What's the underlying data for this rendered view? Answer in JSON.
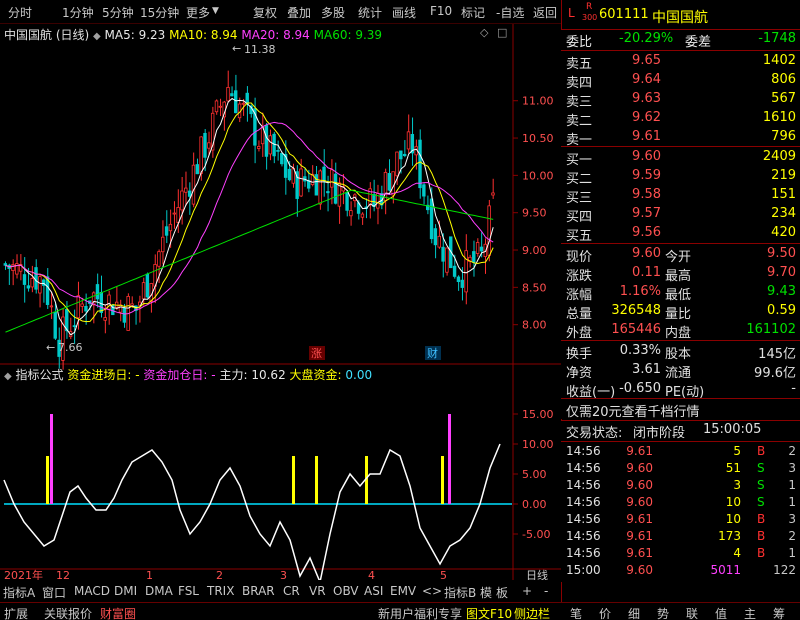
{
  "toolbar": {
    "left": [
      "分时",
      "1分钟",
      "5分钟",
      "15分钟",
      "更多"
    ],
    "right": [
      "复权",
      "叠加",
      "多股",
      "统计",
      "画线",
      "F10",
      "标记",
      "-自选",
      "返回"
    ]
  },
  "chart": {
    "title": "中国国航 (日线)",
    "ma5": "MA5: 9.23",
    "ma10": "MA10: 8.94",
    "ma20": "MA20: 8.94",
    "ma60": "MA60: 9.39",
    "high_label": "11.38",
    "low_label": "7.66",
    "price_ticks": [
      "11.00",
      "10.50",
      "10.00",
      "9.50",
      "9.00",
      "8.50",
      "8.00"
    ],
    "marker_zhang": "涨",
    "marker_cai": "财",
    "colors": {
      "up": "#ff3030",
      "down": "#00c8c8",
      "ma5": "#ffffff",
      "ma10": "#ffff00",
      "ma20": "#ff40ff",
      "ma60": "#00e000"
    }
  },
  "indicator": {
    "name": "指标公式",
    "jczc": "资金进场日:",
    "jczc_v": "-",
    "jjjc": "资金加仓日:",
    "jjjc_v": "-",
    "zl": "主力:",
    "zl_v": "10.62",
    "dp": "大盘资金:",
    "dp_v": "0.00",
    "ticks": [
      "15.00",
      "10.00",
      "5.00",
      "0.00",
      "-5.00"
    ]
  },
  "xaxis": {
    "labels": [
      "2021年",
      "12",
      "1",
      "2",
      "3",
      "4",
      "5"
    ],
    "right": "日线"
  },
  "tabs": [
    "指标A",
    "窗口",
    "MACD",
    "DMI",
    "DMA",
    "FSL",
    "TRIX",
    "BRAR",
    "CR",
    "VR",
    "OBV",
    "ASI",
    "EMV",
    "<",
    ">",
    "指标B",
    "模",
    "板",
    "+",
    "-"
  ],
  "status": {
    "left": [
      "扩展",
      "关联报价",
      "财富圈"
    ],
    "promo": "新用户福利专享",
    "mid": [
      "图文F10",
      "侧边栏"
    ],
    "right": [
      "笔",
      "价",
      "细",
      "势",
      "联",
      "值",
      "主",
      "筹"
    ]
  },
  "quote": {
    "badge_top": "L",
    "badge_r": "R",
    "badge_num": "300",
    "code": "601111",
    "name": "中国国航",
    "weibi_label": "委比",
    "weibi": "-20.29%",
    "weicha_label": "委差",
    "weicha": "-1748",
    "asks": [
      {
        "label": "卖五",
        "price": "9.65",
        "vol": "1402"
      },
      {
        "label": "卖四",
        "price": "9.64",
        "vol": "806"
      },
      {
        "label": "卖三",
        "price": "9.63",
        "vol": "567"
      },
      {
        "label": "卖二",
        "price": "9.62",
        "vol": "1610"
      },
      {
        "label": "卖一",
        "price": "9.61",
        "vol": "796"
      }
    ],
    "bids": [
      {
        "label": "买一",
        "price": "9.60",
        "vol": "2409"
      },
      {
        "label": "买二",
        "price": "9.59",
        "vol": "219"
      },
      {
        "label": "买三",
        "price": "9.58",
        "vol": "151"
      },
      {
        "label": "买四",
        "price": "9.57",
        "vol": "234"
      },
      {
        "label": "买五",
        "price": "9.56",
        "vol": "420"
      }
    ],
    "stats": [
      {
        "l1": "现价",
        "v1": "9.60",
        "l2": "今开",
        "v2": "9.50"
      },
      {
        "l1": "涨跌",
        "v1": "0.11",
        "l2": "最高",
        "v2": "9.70"
      },
      {
        "l1": "涨幅",
        "v1": "1.16%",
        "l2": "最低",
        "v2": "9.43"
      },
      {
        "l1": "总量",
        "v1": "326548",
        "l2": "量比",
        "v2": "0.59"
      },
      {
        "l1": "外盘",
        "v1": "165446",
        "l2": "内盘",
        "v2": "161102"
      }
    ],
    "stats2": [
      {
        "l1": "换手",
        "v1": "0.33%",
        "l2": "股本",
        "v2": "145亿"
      },
      {
        "l1": "净资",
        "v1": "3.61",
        "l2": "流通",
        "v2": "99.6亿"
      },
      {
        "l1": "收益(一)",
        "v1": "-0.650",
        "l2": "PE(动)",
        "v2": "-"
      }
    ],
    "promo": "仅需20元查看千档行情",
    "trade_status_label": "交易状态:",
    "trade_status": "闭市阶段",
    "trade_time": "15:00:05",
    "ticks": [
      {
        "t": "14:56",
        "p": "9.61",
        "v": "5",
        "d": "B",
        "n": "2"
      },
      {
        "t": "14:56",
        "p": "9.60",
        "v": "51",
        "d": "S",
        "n": "3"
      },
      {
        "t": "14:56",
        "p": "9.60",
        "v": "3",
        "d": "S",
        "n": "1"
      },
      {
        "t": "14:56",
        "p": "9.60",
        "v": "10",
        "d": "S",
        "n": "1"
      },
      {
        "t": "14:56",
        "p": "9.61",
        "v": "10",
        "d": "B",
        "n": "3"
      },
      {
        "t": "14:56",
        "p": "9.61",
        "v": "173",
        "d": "B",
        "n": "2"
      },
      {
        "t": "14:56",
        "p": "9.61",
        "v": "4",
        "d": "B",
        "n": "1"
      },
      {
        "t": "15:00",
        "p": "9.60",
        "v": "5011",
        "d": "",
        "n": "122"
      }
    ]
  }
}
